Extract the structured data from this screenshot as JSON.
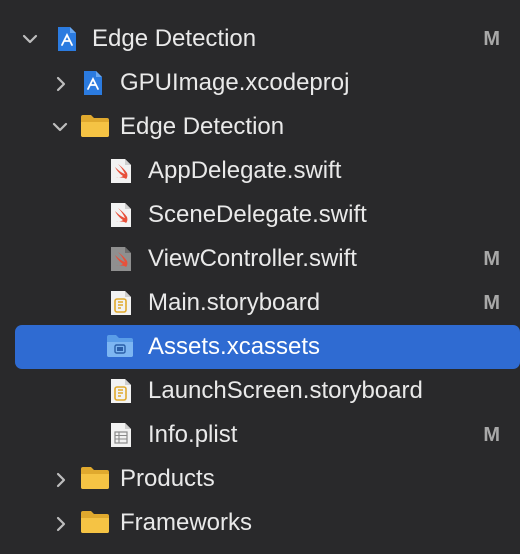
{
  "navigator": {
    "root": {
      "label": "Edge Detection",
      "badge": "M",
      "icon": "xcode-project-icon"
    },
    "items": [
      {
        "label": "GPUImage.xcodeproj",
        "badge": "",
        "icon": "xcode-project-icon"
      },
      {
        "label": "Edge Detection",
        "badge": "",
        "icon": "folder-icon"
      },
      {
        "label": "AppDelegate.swift",
        "badge": "",
        "icon": "swift-file-icon"
      },
      {
        "label": "SceneDelegate.swift",
        "badge": "",
        "icon": "swift-file-icon"
      },
      {
        "label": "ViewController.swift",
        "badge": "M",
        "icon": "swift-file-icon"
      },
      {
        "label": "Main.storyboard",
        "badge": "M",
        "icon": "storyboard-file-icon"
      },
      {
        "label": "Assets.xcassets",
        "badge": "",
        "icon": "asset-catalog-icon"
      },
      {
        "label": "LaunchScreen.storyboard",
        "badge": "",
        "icon": "storyboard-file-icon"
      },
      {
        "label": "Info.plist",
        "badge": "M",
        "icon": "plist-file-icon"
      },
      {
        "label": "Products",
        "badge": "",
        "icon": "folder-icon"
      },
      {
        "label": "Frameworks",
        "badge": "",
        "icon": "folder-icon"
      }
    ]
  },
  "colors": {
    "background": "#29292b",
    "selection": "#2f6bd2",
    "folder": "#f5c344",
    "swift": "#e8503a",
    "project_blue": "#2b7be0",
    "badge": "#a8a8a8"
  }
}
